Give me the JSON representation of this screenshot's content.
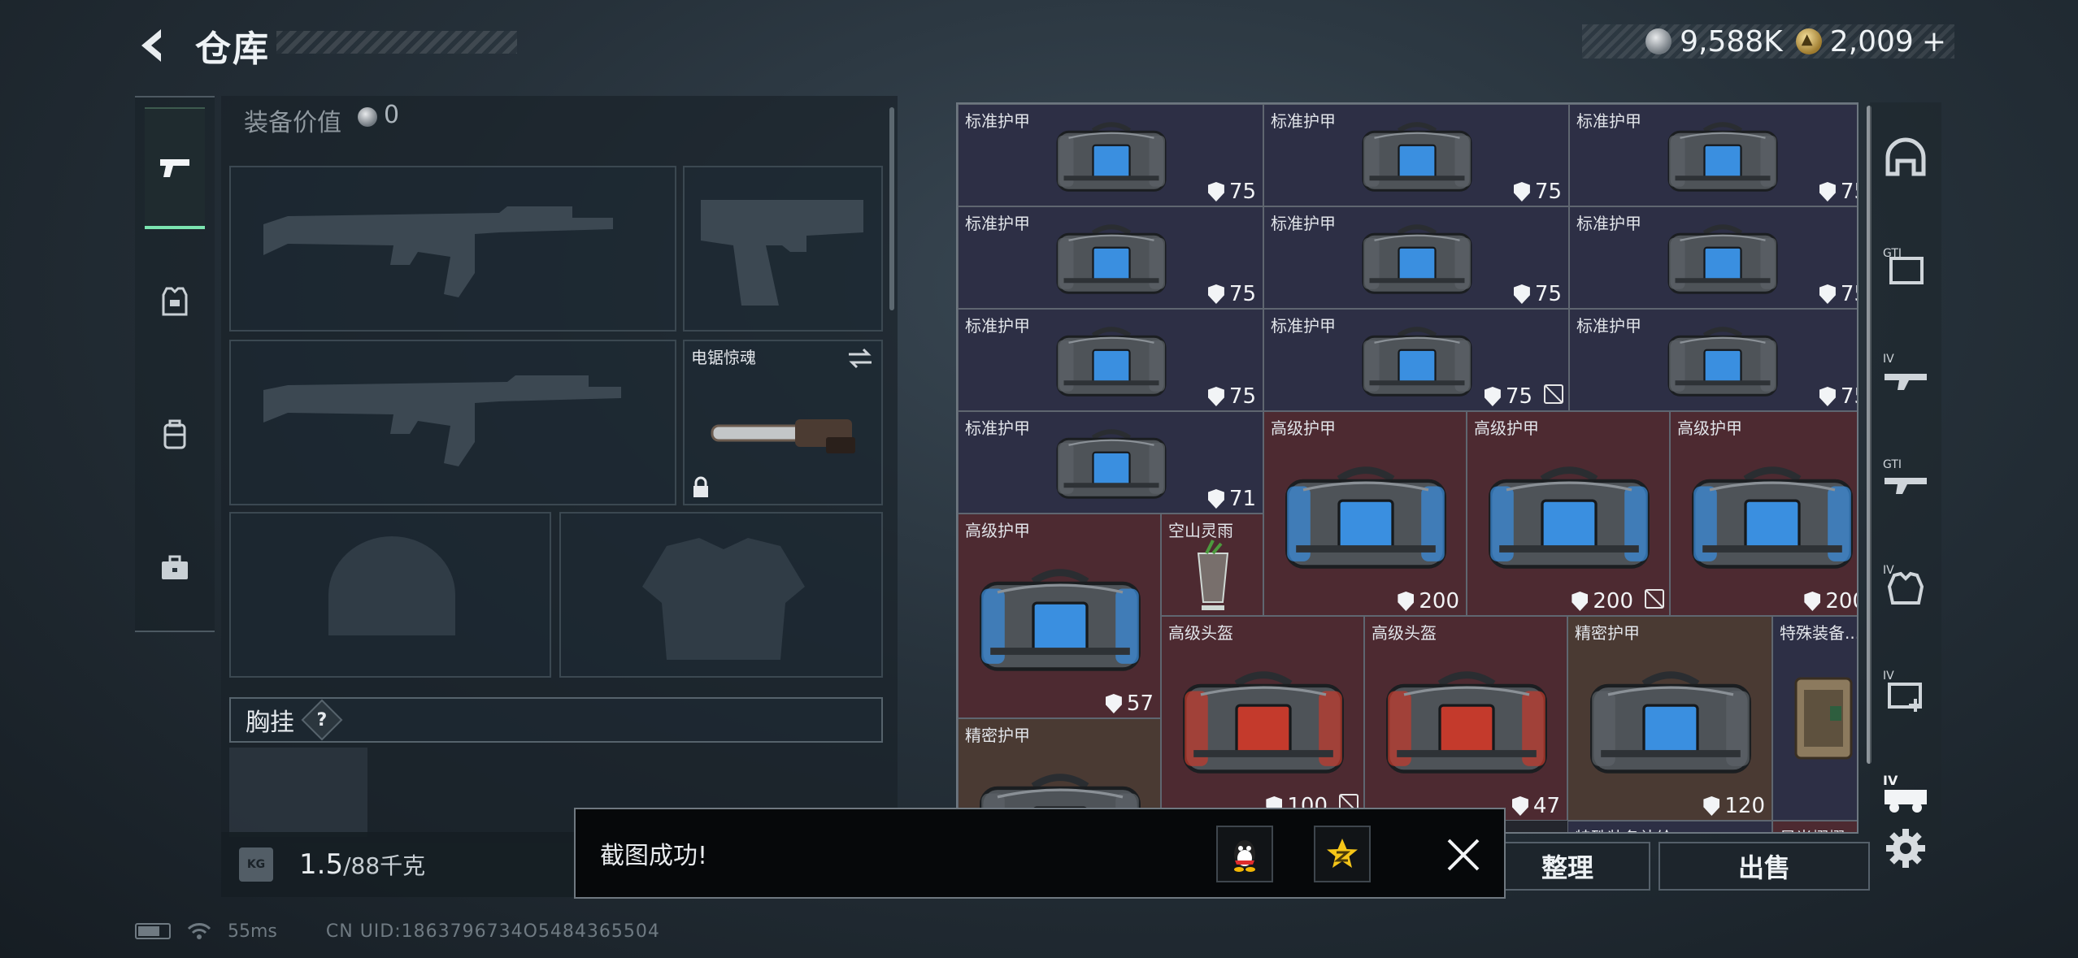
{
  "header": {
    "title": "仓库"
  },
  "currency": {
    "silver": "9,588K",
    "gold": "2,009",
    "gold_add": "+"
  },
  "left_tabs": [
    {
      "name": "weapons-tab",
      "icon": "pistol-icon"
    },
    {
      "name": "armor-tab",
      "icon": "armor-vest-icon"
    },
    {
      "name": "backpack-tab",
      "icon": "backpack-icon"
    },
    {
      "name": "case-tab",
      "icon": "briefcase-icon"
    }
  ],
  "equipment": {
    "value_label": "装备价值",
    "value": "0",
    "melee_name": "电锯惊魂",
    "chest_rig_label": "胸挂",
    "chest_rig_help": "?"
  },
  "weight": {
    "icon_text": "KG",
    "current": "1.5",
    "max": "/88千克"
  },
  "inventory": {
    "items": [
      {
        "name": "标准护甲",
        "dur": "75",
        "nosell": false,
        "color": "blue",
        "kind": "bag-blue"
      },
      {
        "name": "标准护甲",
        "dur": "75",
        "nosell": false,
        "color": "blue",
        "kind": "bag-blue"
      },
      {
        "name": "标准护甲",
        "dur": "75",
        "nosell": false,
        "color": "blue",
        "kind": "bag-blue"
      },
      {
        "name": "标准护甲",
        "dur": "75",
        "nosell": false,
        "color": "blue",
        "kind": "bag-blue"
      },
      {
        "name": "标准护甲",
        "dur": "75",
        "nosell": false,
        "color": "blue",
        "kind": "bag-blue"
      },
      {
        "name": "标准护甲",
        "dur": "75",
        "nosell": false,
        "color": "blue",
        "kind": "bag-blue"
      },
      {
        "name": "标准护甲",
        "dur": "75",
        "nosell": false,
        "color": "blue",
        "kind": "bag-blue"
      },
      {
        "name": "标准护甲",
        "dur": "75",
        "nosell": true,
        "color": "blue",
        "kind": "bag-blue"
      },
      {
        "name": "标准护甲",
        "dur": "75",
        "nosell": false,
        "color": "blue",
        "kind": "bag-blue"
      },
      {
        "name": "标准护甲",
        "dur": "71",
        "nosell": false,
        "color": "blue",
        "kind": "bag-blue"
      },
      {
        "name": "高级护甲",
        "dur": "200",
        "nosell": false,
        "color": "red",
        "kind": "bag-big"
      },
      {
        "name": "高级护甲",
        "dur": "200",
        "nosell": true,
        "color": "red",
        "kind": "bag-big"
      },
      {
        "name": "高级护甲",
        "dur": "200",
        "nosell": false,
        "color": "red",
        "kind": "bag-big"
      },
      {
        "name": "高级护甲",
        "dur": "57",
        "nosell": false,
        "color": "red",
        "kind": "bag-big"
      },
      {
        "name": "空山灵雨",
        "dur": "",
        "nosell": false,
        "color": "red",
        "kind": "drink"
      },
      {
        "name": "高级头盔",
        "dur": "100",
        "nosell": true,
        "color": "red",
        "kind": "bag-helmet"
      },
      {
        "name": "高级头盔",
        "dur": "47",
        "nosell": false,
        "color": "red",
        "kind": "bag-helmet"
      },
      {
        "name": "精密护甲",
        "dur": "120",
        "nosell": false,
        "color": "tan",
        "kind": "bag-dark"
      },
      {
        "name": "特殊装备...",
        "dur": "",
        "nosell": false,
        "color": "blue",
        "kind": "case"
      },
      {
        "name": "精密护甲",
        "dur": "",
        "nosell": false,
        "color": "tan",
        "kind": "bag-dark"
      },
      {
        "name": "特殊装备补给",
        "dur": "",
        "nosell": false,
        "color": "blue",
        "kind": "none"
      },
      {
        "name": "星光熠熠",
        "dur": "",
        "nosell": false,
        "color": "red",
        "kind": "none"
      }
    ]
  },
  "right_tabs": [
    {
      "name": "all-category-tab",
      "icon": "helmet-outline-icon"
    },
    {
      "name": "gti-armor-tab",
      "icon": "gti-armor-icon"
    },
    {
      "name": "iv-weapon-tab",
      "icon": "iv-rifle-icon"
    },
    {
      "name": "gti-weapon-tab",
      "icon": "gti-rifle-icon"
    },
    {
      "name": "iv-armor-tab",
      "icon": "iv-vest-icon"
    },
    {
      "name": "iv-medical-tab",
      "icon": "iv-medkit-icon"
    },
    {
      "name": "iv-vehicle-tab",
      "icon": "iv-vehicle-icon"
    }
  ],
  "actions": {
    "sort": "整理",
    "sell": "出售"
  },
  "toast": {
    "message": "截图成功!"
  },
  "status": {
    "ping": "55ms",
    "uid": "CN UID:1863796734O5484365504"
  }
}
